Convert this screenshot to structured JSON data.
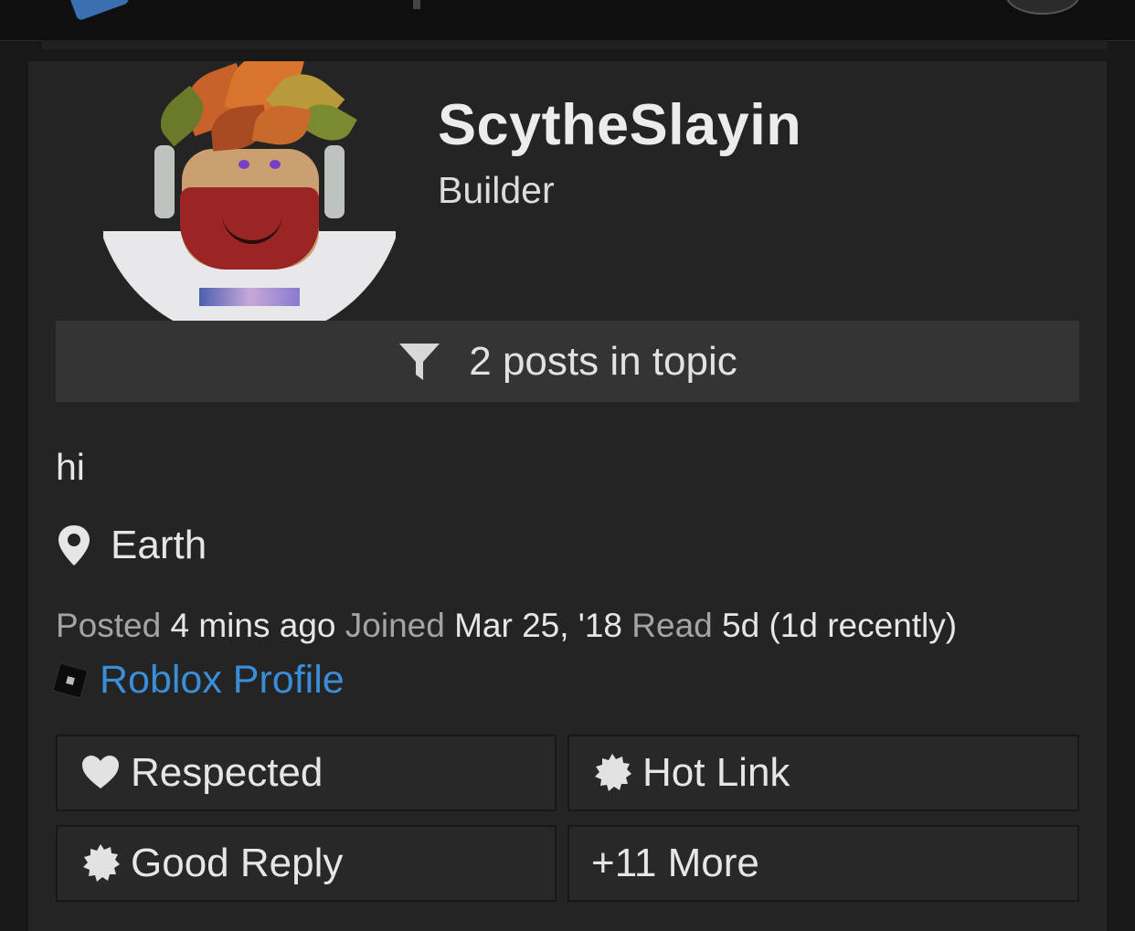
{
  "user": {
    "name": "ScytheSlayin",
    "title": "Builder"
  },
  "topic_filter": {
    "label": "2 posts in topic",
    "icon": "filter-icon"
  },
  "post": {
    "body": "hi"
  },
  "location": {
    "text": "Earth",
    "icon": "map-pin-icon"
  },
  "meta": {
    "posted_key": "Posted",
    "posted_val": "4 mins ago",
    "joined_key": "Joined",
    "joined_val": "Mar 25, '18",
    "read_key": "Read",
    "read_val": "5d (1d recently)"
  },
  "profile_link": {
    "label": "Roblox Profile",
    "icon": "roblox-logo-icon"
  },
  "badges": [
    {
      "label": "Respected",
      "icon": "heart-icon"
    },
    {
      "label": "Hot Link",
      "icon": "badge-seal-icon"
    },
    {
      "label": "Good Reply",
      "icon": "badge-seal-icon"
    },
    {
      "label": "+11 More"
    }
  ],
  "colors": {
    "page_bg": "#181818",
    "card_bg": "#242424",
    "filter_bg": "#343434",
    "link": "#3a8ed8",
    "muted_text": "#a4a4a4",
    "text": "#e6e6e6"
  }
}
